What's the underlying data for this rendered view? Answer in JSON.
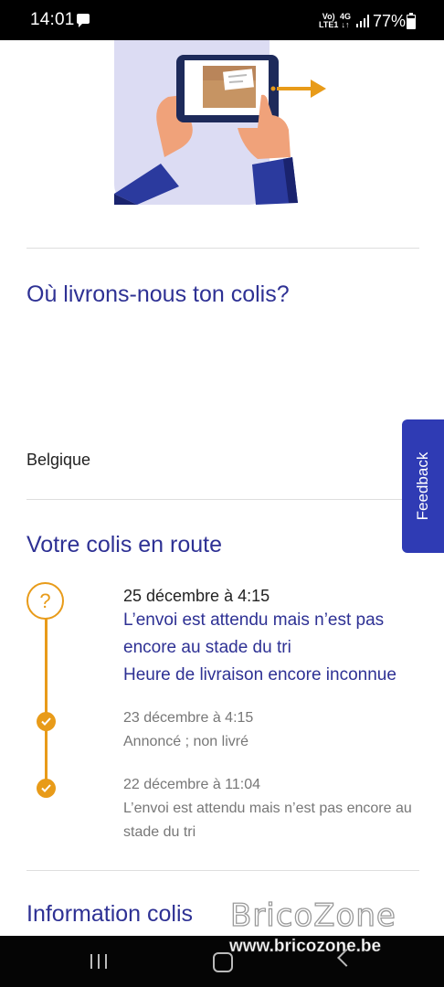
{
  "status_bar": {
    "time": "14:01",
    "volte": "Vo)\nLTE1",
    "network": "4G",
    "battery": "77%",
    "battery_level": 0.77
  },
  "delivery": {
    "heading": "Où livrons-nous ton colis?",
    "country": "Belgique"
  },
  "feedback": {
    "label": "Feedback"
  },
  "tracking": {
    "heading": "Votre colis en route",
    "current": {
      "icon": "question-mark",
      "date": "25 décembre à 4:15",
      "status": "L’envoi est attendu mais n’est pas encore au stade du tri\nHeure de livraison encore inconnue"
    },
    "events": [
      {
        "date": "23 décembre à 4:15",
        "description": "Annoncé ; non livré"
      },
      {
        "date": "22 décembre à 11:04",
        "description": "L’envoi est attendu mais n’est pas encore au stade du tri"
      }
    ]
  },
  "package_info": {
    "heading": "Information colis"
  },
  "watermark": {
    "brand": "BricoZone",
    "url": "www.bricozone.be"
  },
  "colors": {
    "primary": "#2e3194",
    "accent": "#e89b19",
    "feedback": "#2f3bb4"
  }
}
